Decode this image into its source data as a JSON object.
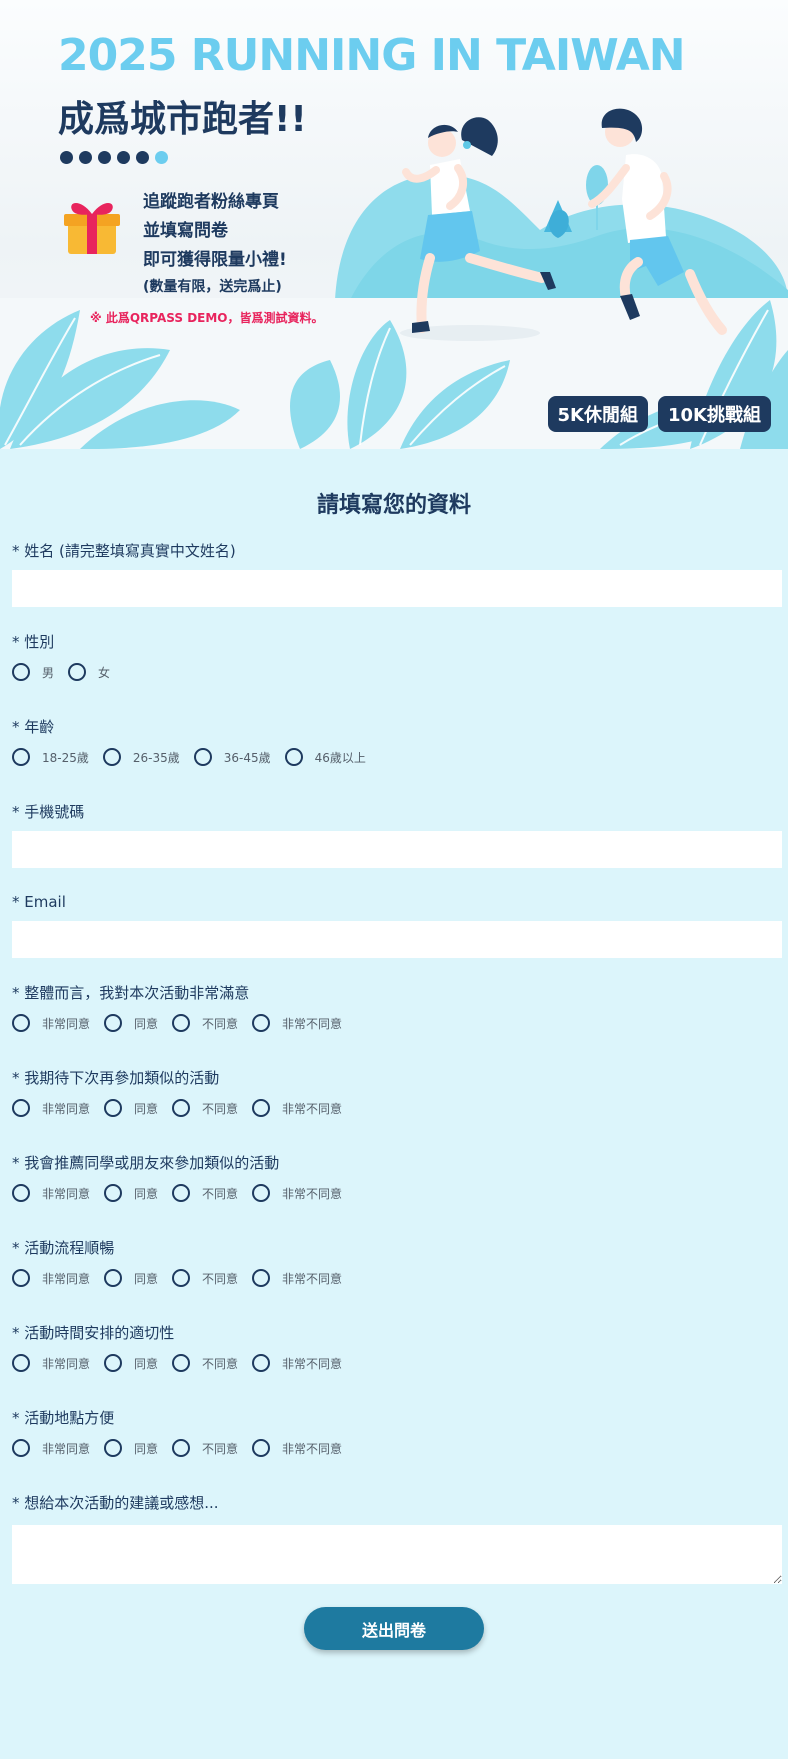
{
  "banner": {
    "title": "2025 RUNNING IN TAIWAN",
    "subtitle": "成爲城市跑者!!",
    "promo_lines": [
      "追蹤跑者粉絲專頁",
      "並填寫問卷",
      "即可獲得限量小禮!"
    ],
    "promo_note": "(數量有限，送完爲止)",
    "demo_note": "※ 此爲QRPASS DEMO，皆爲測試資料。",
    "group_tags": [
      "5K休閒組",
      "10K挑戰組"
    ],
    "dot_count": 6,
    "active_dot": 5
  },
  "form": {
    "title": "請填寫您的資料",
    "name": {
      "label": "* 姓名 (請完整填寫真實中文姓名)",
      "value": "",
      "placeholder": ""
    },
    "gender": {
      "label": "* 性別",
      "options": [
        "男",
        "女"
      ]
    },
    "age": {
      "label": "* 年齡",
      "options": [
        "18-25歲",
        "26-35歲",
        "36-45歲",
        "46歲以上"
      ]
    },
    "phone": {
      "label": "* 手機號碼",
      "value": "",
      "placeholder": ""
    },
    "email": {
      "label": "* Email",
      "value": "",
      "placeholder": ""
    },
    "likert_options": [
      "非常同意",
      "同意",
      "不同意",
      "非常不同意"
    ],
    "q1": {
      "label": "* 整體而言，我對本次活動非常滿意"
    },
    "q2": {
      "label": "* 我期待下次再參加類似的活動"
    },
    "q3": {
      "label": "* 我會推薦同學或朋友來參加類似的活動"
    },
    "q4": {
      "label": "* 活動流程順暢"
    },
    "q5": {
      "label": "* 活動時間安排的適切性"
    },
    "q6": {
      "label": "* 活動地點方便"
    },
    "feedback": {
      "label": "* 想給本次活動的建議或感想...",
      "value": ""
    },
    "submit_label": "送出問卷"
  },
  "colors": {
    "page_bg": "#dcf5fb",
    "navy": "#1e3a5f",
    "accent_blue": "#6ccdef",
    "demo_pink": "#e8245d",
    "submit_bg": "#1e7aa0"
  },
  "icons": [
    "gift-icon",
    "runner-woman-illustration",
    "runner-man-illustration",
    "leaf-illustration"
  ]
}
